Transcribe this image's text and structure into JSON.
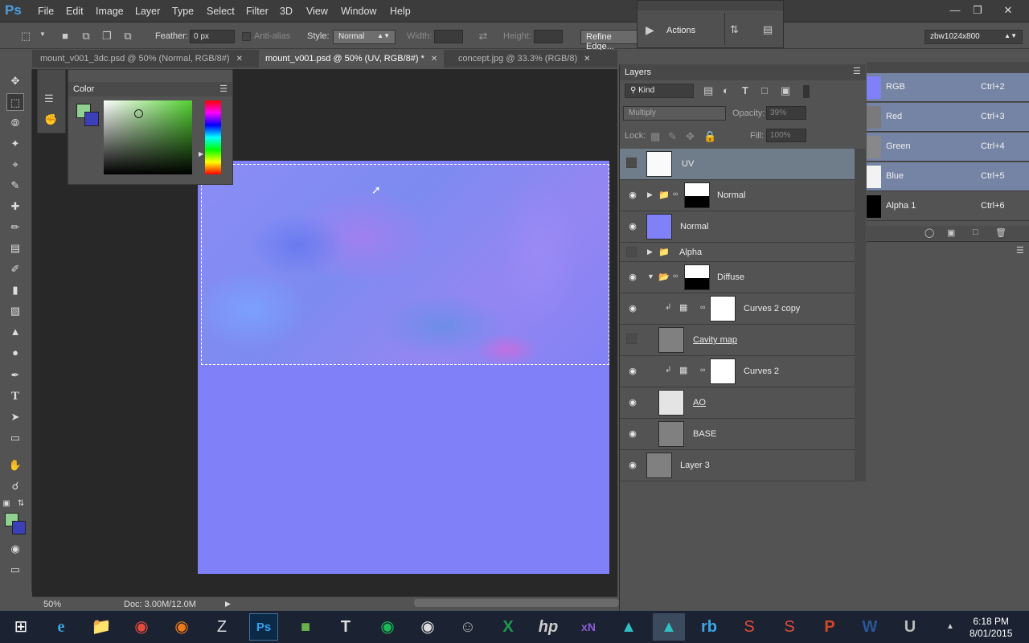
{
  "app": {
    "logo": "Ps"
  },
  "menu": [
    "File",
    "Edit",
    "Image",
    "Layer",
    "Type",
    "Select",
    "Filter",
    "3D",
    "View",
    "Window",
    "Help"
  ],
  "options": {
    "feather_label": "Feather:",
    "feather_value": "0 px",
    "antialias_label": "Anti-alias",
    "style_label": "Style:",
    "style_value": "Normal",
    "width_label": "Width:",
    "height_label": "Height:",
    "refine_edge": "Refine Edge...",
    "workspace": "zbw1024x800"
  },
  "actions_panel": {
    "label": "Actions"
  },
  "tabs": [
    {
      "label": "mount_v001_3dc.psd @ 50% (Normal, RGB/8#)"
    },
    {
      "label": "mount_v001.psd @ 50% (UV, RGB/8#) *"
    },
    {
      "label": "concept.jpg @ 33.3% (RGB/8)"
    }
  ],
  "color_panel": {
    "title": "Color",
    "fg": "#90d090",
    "bg": "#3b3fb8"
  },
  "status": {
    "zoom": "50%",
    "doc": "Doc: 3.00M/12.0M"
  },
  "layers_panel": {
    "title": "Layers",
    "filter": "Kind",
    "blend_mode": "Multiply",
    "opacity_label": "Opacity:",
    "opacity_value": "39%",
    "lock_label": "Lock:",
    "fill_label": "Fill:",
    "fill_value": "100%",
    "layers": [
      {
        "name": "UV"
      },
      {
        "name": "Normal"
      },
      {
        "name": "Normal"
      },
      {
        "name": "Alpha"
      },
      {
        "name": "Diffuse"
      },
      {
        "name": "Curves 2 copy"
      },
      {
        "name": "Cavity map"
      },
      {
        "name": "Curves 2"
      },
      {
        "name": "AO"
      },
      {
        "name": "BASE"
      },
      {
        "name": "Layer 3"
      }
    ]
  },
  "channels": [
    {
      "name": "RGB",
      "key": "Ctrl+2"
    },
    {
      "name": "Red",
      "key": "Ctrl+3"
    },
    {
      "name": "Green",
      "key": "Ctrl+4"
    },
    {
      "name": "Blue",
      "key": "Ctrl+5"
    },
    {
      "name": "Alpha 1",
      "key": "Ctrl+6"
    }
  ],
  "taskbar": {
    "time": "6:18 PM",
    "date": "8/01/2015"
  }
}
